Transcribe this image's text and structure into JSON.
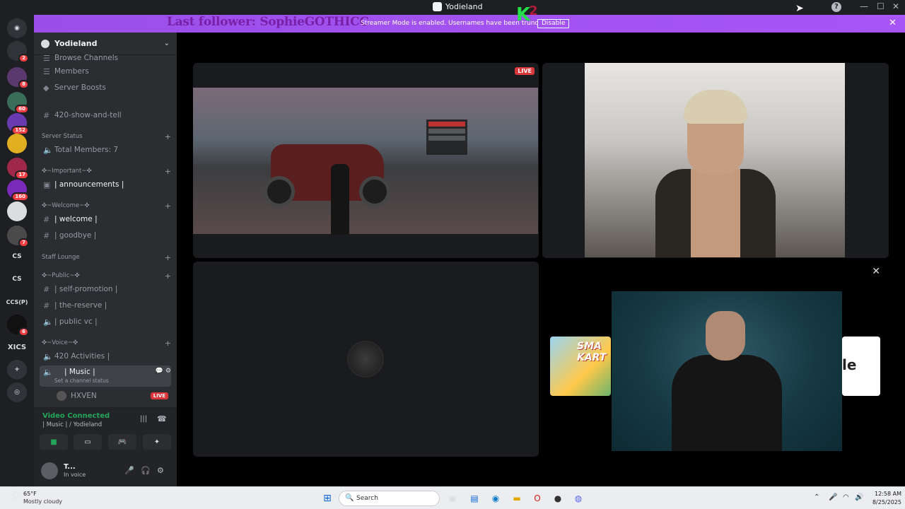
{
  "window": {
    "title": "Yodieland"
  },
  "banner": {
    "follower": "Last follower: SophieGOTHICC",
    "message": "Streamer Mode is enabled. Usernames have been trunc",
    "disable_label": "Disable",
    "k_letter": "K",
    "k_number": "2"
  },
  "guilds": [
    {
      "label": "",
      "badge": "2"
    },
    {
      "label": "",
      "badge": "8"
    },
    {
      "label": "",
      "badge": "60"
    },
    {
      "label": "",
      "badge": "152"
    },
    {
      "label": "",
      "badge": ""
    },
    {
      "label": "",
      "badge": "17"
    },
    {
      "label": "",
      "badge": "160"
    },
    {
      "label": "",
      "badge": ""
    },
    {
      "label": "",
      "badge": "7"
    },
    {
      "label": "CS",
      "badge": ""
    },
    {
      "label": "CS",
      "badge": ""
    },
    {
      "label": "CCS(P)",
      "badge": ""
    },
    {
      "label": "",
      "badge": "6"
    },
    {
      "label": "XICS",
      "badge": ""
    },
    {
      "label": "+",
      "badge": ""
    },
    {
      "label": "",
      "badge": ""
    }
  ],
  "sidebar": {
    "server_name": "Yodieland",
    "items": {
      "browse": "Browse Channels",
      "members": "Members",
      "boosts": "Server Boosts",
      "showtell": "420-show-and-tell",
      "server_status_cat": "Server Status",
      "total_members": "Total Members: 7",
      "important_cat": "✜~Important~✜",
      "announcements": "| announcements |",
      "welcome_cat": "✜~Welcome~✜",
      "welcome": "| welcome |",
      "goodbye": "| goodbye |",
      "staff_cat": "Staff Lounge",
      "public_cat": "✜~Public~✜",
      "selfpromo": "| self-promotion |",
      "reserve": "| the-reserve |",
      "publicvc": "| public vc |",
      "voice_cat": "✜~Voice~✜",
      "activities": "420 Activities |",
      "music": "| Music |",
      "music_status": "Set a channel status",
      "hxven": "HXVEN",
      "live": "LIVE"
    }
  },
  "voice": {
    "status": "Video Connected",
    "channel": "| Music | / Yodieland"
  },
  "user": {
    "name": "T...",
    "status": "In voice"
  },
  "stage": {
    "live_label": "LIVE"
  },
  "taskbar": {
    "temp": "65°F",
    "weather": "Mostly cloudy",
    "search": "Search",
    "time": "12:58 AM",
    "date": "8/25/2025",
    "kart_text": "SMA KART",
    "dlabel": "le"
  }
}
